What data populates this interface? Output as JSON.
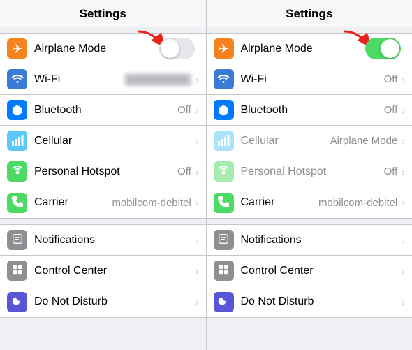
{
  "panels": [
    {
      "id": "panel-left",
      "header": "Settings",
      "airplane_toggle": "off",
      "groups": [
        {
          "id": "network",
          "rows": [
            {
              "id": "airplane",
              "icon_bg": "icon-orange",
              "icon": "✈",
              "label": "Airplane Mode",
              "value": "",
              "showToggle": true,
              "toggleOn": false,
              "showChevron": false,
              "dimmed": false
            },
            {
              "id": "wifi",
              "icon_bg": "icon-blue",
              "icon": "wifi",
              "label": "Wi-Fi",
              "value": "blurred",
              "showToggle": false,
              "showChevron": true,
              "dimmed": false
            },
            {
              "id": "bluetooth",
              "icon_bg": "icon-blue-dark",
              "icon": "bt",
              "label": "Bluetooth",
              "value": "Off",
              "showToggle": false,
              "showChevron": true,
              "dimmed": false
            },
            {
              "id": "cellular",
              "icon_bg": "icon-green-light",
              "icon": "cell",
              "label": "Cellular",
              "value": "",
              "showToggle": false,
              "showChevron": true,
              "dimmed": false
            },
            {
              "id": "hotspot",
              "icon_bg": "icon-green",
              "icon": "hot",
              "label": "Personal Hotspot",
              "value": "Off",
              "showToggle": false,
              "showChevron": true,
              "dimmed": false
            },
            {
              "id": "carrier",
              "icon_bg": "icon-green",
              "icon": "phone",
              "label": "Carrier",
              "value": "mobilcom-debitel",
              "showToggle": false,
              "showChevron": true,
              "dimmed": false
            }
          ]
        },
        {
          "id": "misc",
          "rows": [
            {
              "id": "notifications",
              "icon_bg": "icon-gray",
              "icon": "notif",
              "label": "Notifications",
              "value": "",
              "showToggle": false,
              "showChevron": true,
              "dimmed": false
            },
            {
              "id": "controlcenter",
              "icon_bg": "icon-gray",
              "icon": "ctrl",
              "label": "Control Center",
              "value": "",
              "showToggle": false,
              "showChevron": true,
              "dimmed": false
            },
            {
              "id": "donotdisturb",
              "icon_bg": "icon-purple",
              "icon": "moon",
              "label": "Do Not Disturb",
              "value": "",
              "showToggle": false,
              "showChevron": true,
              "dimmed": false
            }
          ]
        }
      ]
    },
    {
      "id": "panel-right",
      "header": "Settings",
      "airplane_toggle": "on",
      "groups": [
        {
          "id": "network",
          "rows": [
            {
              "id": "airplane",
              "icon_bg": "icon-orange",
              "icon": "✈",
              "label": "Airplane Mode",
              "value": "",
              "showToggle": true,
              "toggleOn": true,
              "showChevron": false,
              "dimmed": false
            },
            {
              "id": "wifi",
              "icon_bg": "icon-blue",
              "icon": "wifi",
              "label": "Wi-Fi",
              "value": "Off",
              "showToggle": false,
              "showChevron": true,
              "dimmed": false
            },
            {
              "id": "bluetooth",
              "icon_bg": "icon-blue-dark",
              "icon": "bt",
              "label": "Bluetooth",
              "value": "Off",
              "showToggle": false,
              "showChevron": true,
              "dimmed": false
            },
            {
              "id": "cellular",
              "icon_bg": "icon-green-light",
              "icon": "cell",
              "label": "Cellular",
              "value": "Airplane Mode",
              "showToggle": false,
              "showChevron": true,
              "dimmed": true
            },
            {
              "id": "hotspot",
              "icon_bg": "icon-green",
              "icon": "hot",
              "label": "Personal Hotspot",
              "value": "Off",
              "showToggle": false,
              "showChevron": true,
              "dimmed": true
            },
            {
              "id": "carrier",
              "icon_bg": "icon-green",
              "icon": "phone",
              "label": "Carrier",
              "value": "mobilcom-debitel",
              "showToggle": false,
              "showChevron": true,
              "dimmed": false
            }
          ]
        },
        {
          "id": "misc",
          "rows": [
            {
              "id": "notifications",
              "icon_bg": "icon-gray",
              "icon": "notif",
              "label": "Notifications",
              "value": "",
              "showToggle": false,
              "showChevron": true,
              "dimmed": false
            },
            {
              "id": "controlcenter",
              "icon_bg": "icon-gray",
              "icon": "ctrl",
              "label": "Control Center",
              "value": "",
              "showToggle": false,
              "showChevron": true,
              "dimmed": false
            },
            {
              "id": "donotdisturb",
              "icon_bg": "icon-purple",
              "icon": "moon",
              "label": "Do Not Disturb",
              "value": "",
              "showToggle": false,
              "showChevron": true,
              "dimmed": false
            }
          ]
        }
      ]
    }
  ]
}
